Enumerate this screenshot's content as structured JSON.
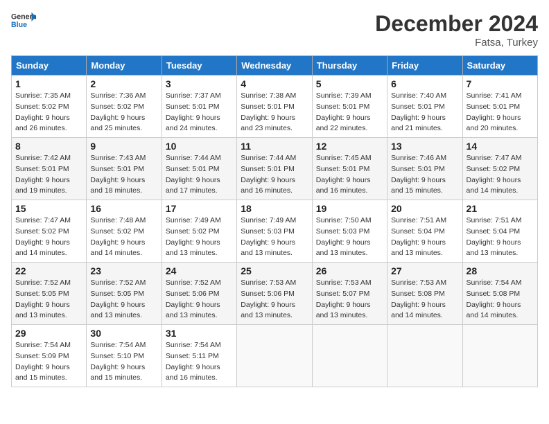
{
  "header": {
    "logo_general": "General",
    "logo_blue": "Blue",
    "month": "December 2024",
    "location": "Fatsa, Turkey"
  },
  "weekdays": [
    "Sunday",
    "Monday",
    "Tuesday",
    "Wednesday",
    "Thursday",
    "Friday",
    "Saturday"
  ],
  "weeks": [
    [
      {
        "day": "1",
        "sunrise": "7:35 AM",
        "sunset": "5:02 PM",
        "daylight": "9 hours and 26 minutes."
      },
      {
        "day": "2",
        "sunrise": "7:36 AM",
        "sunset": "5:02 PM",
        "daylight": "9 hours and 25 minutes."
      },
      {
        "day": "3",
        "sunrise": "7:37 AM",
        "sunset": "5:01 PM",
        "daylight": "9 hours and 24 minutes."
      },
      {
        "day": "4",
        "sunrise": "7:38 AM",
        "sunset": "5:01 PM",
        "daylight": "9 hours and 23 minutes."
      },
      {
        "day": "5",
        "sunrise": "7:39 AM",
        "sunset": "5:01 PM",
        "daylight": "9 hours and 22 minutes."
      },
      {
        "day": "6",
        "sunrise": "7:40 AM",
        "sunset": "5:01 PM",
        "daylight": "9 hours and 21 minutes."
      },
      {
        "day": "7",
        "sunrise": "7:41 AM",
        "sunset": "5:01 PM",
        "daylight": "9 hours and 20 minutes."
      }
    ],
    [
      {
        "day": "8",
        "sunrise": "7:42 AM",
        "sunset": "5:01 PM",
        "daylight": "9 hours and 19 minutes."
      },
      {
        "day": "9",
        "sunrise": "7:43 AM",
        "sunset": "5:01 PM",
        "daylight": "9 hours and 18 minutes."
      },
      {
        "day": "10",
        "sunrise": "7:44 AM",
        "sunset": "5:01 PM",
        "daylight": "9 hours and 17 minutes."
      },
      {
        "day": "11",
        "sunrise": "7:44 AM",
        "sunset": "5:01 PM",
        "daylight": "9 hours and 16 minutes."
      },
      {
        "day": "12",
        "sunrise": "7:45 AM",
        "sunset": "5:01 PM",
        "daylight": "9 hours and 16 minutes."
      },
      {
        "day": "13",
        "sunrise": "7:46 AM",
        "sunset": "5:01 PM",
        "daylight": "9 hours and 15 minutes."
      },
      {
        "day": "14",
        "sunrise": "7:47 AM",
        "sunset": "5:02 PM",
        "daylight": "9 hours and 14 minutes."
      }
    ],
    [
      {
        "day": "15",
        "sunrise": "7:47 AM",
        "sunset": "5:02 PM",
        "daylight": "9 hours and 14 minutes."
      },
      {
        "day": "16",
        "sunrise": "7:48 AM",
        "sunset": "5:02 PM",
        "daylight": "9 hours and 14 minutes."
      },
      {
        "day": "17",
        "sunrise": "7:49 AM",
        "sunset": "5:02 PM",
        "daylight": "9 hours and 13 minutes."
      },
      {
        "day": "18",
        "sunrise": "7:49 AM",
        "sunset": "5:03 PM",
        "daylight": "9 hours and 13 minutes."
      },
      {
        "day": "19",
        "sunrise": "7:50 AM",
        "sunset": "5:03 PM",
        "daylight": "9 hours and 13 minutes."
      },
      {
        "day": "20",
        "sunrise": "7:51 AM",
        "sunset": "5:04 PM",
        "daylight": "9 hours and 13 minutes."
      },
      {
        "day": "21",
        "sunrise": "7:51 AM",
        "sunset": "5:04 PM",
        "daylight": "9 hours and 13 minutes."
      }
    ],
    [
      {
        "day": "22",
        "sunrise": "7:52 AM",
        "sunset": "5:05 PM",
        "daylight": "9 hours and 13 minutes."
      },
      {
        "day": "23",
        "sunrise": "7:52 AM",
        "sunset": "5:05 PM",
        "daylight": "9 hours and 13 minutes."
      },
      {
        "day": "24",
        "sunrise": "7:52 AM",
        "sunset": "5:06 PM",
        "daylight": "9 hours and 13 minutes."
      },
      {
        "day": "25",
        "sunrise": "7:53 AM",
        "sunset": "5:06 PM",
        "daylight": "9 hours and 13 minutes."
      },
      {
        "day": "26",
        "sunrise": "7:53 AM",
        "sunset": "5:07 PM",
        "daylight": "9 hours and 13 minutes."
      },
      {
        "day": "27",
        "sunrise": "7:53 AM",
        "sunset": "5:08 PM",
        "daylight": "9 hours and 14 minutes."
      },
      {
        "day": "28",
        "sunrise": "7:54 AM",
        "sunset": "5:08 PM",
        "daylight": "9 hours and 14 minutes."
      }
    ],
    [
      {
        "day": "29",
        "sunrise": "7:54 AM",
        "sunset": "5:09 PM",
        "daylight": "9 hours and 15 minutes."
      },
      {
        "day": "30",
        "sunrise": "7:54 AM",
        "sunset": "5:10 PM",
        "daylight": "9 hours and 15 minutes."
      },
      {
        "day": "31",
        "sunrise": "7:54 AM",
        "sunset": "5:11 PM",
        "daylight": "9 hours and 16 minutes."
      },
      null,
      null,
      null,
      null
    ]
  ],
  "labels": {
    "sunrise": "Sunrise:",
    "sunset": "Sunset:",
    "daylight": "Daylight:"
  }
}
